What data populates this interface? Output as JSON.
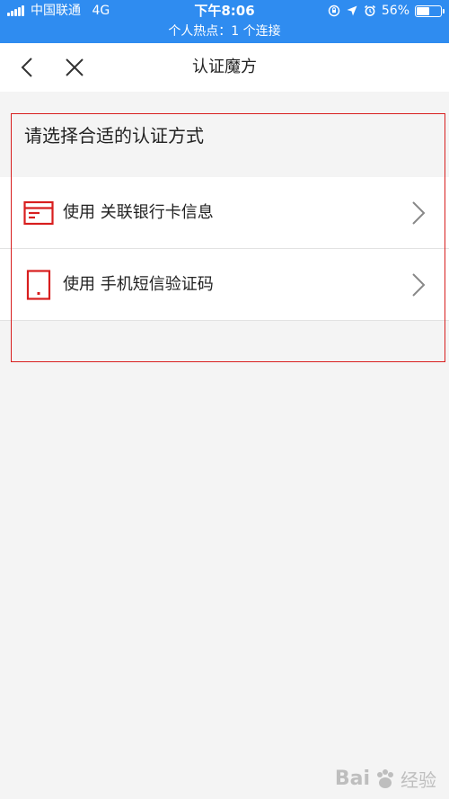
{
  "status_bar": {
    "carrier": "中国联通",
    "network": "4G",
    "time": "下午8:06",
    "battery_percent": "56%",
    "battery_level": 0.56,
    "hotspot": "个人热点：1 个连接",
    "background_color": "#2f8cf0"
  },
  "nav": {
    "title": "认证魔方",
    "back_icon": "chevron-left-icon",
    "close_icon": "close-icon"
  },
  "section": {
    "title": "请选择合适的认证方式"
  },
  "options": [
    {
      "label": "使用 关联银行卡信息",
      "icon": "bank-card-icon"
    },
    {
      "label": "使用 手机短信验证码",
      "icon": "phone-icon"
    }
  ],
  "colors": {
    "accent_red": "#d81e1e",
    "text": "#222222",
    "page_background": "#f4f4f4"
  },
  "watermark": {
    "brand": "Bai",
    "brand_suffix": "经验"
  }
}
